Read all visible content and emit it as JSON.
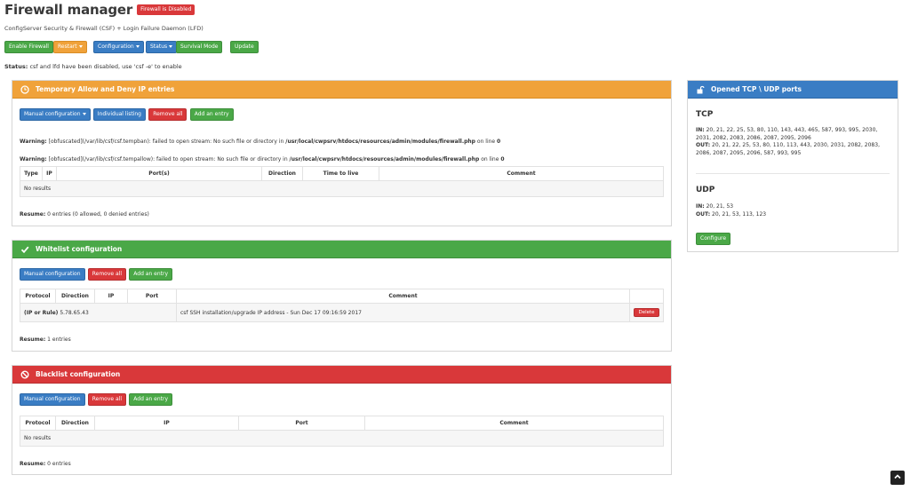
{
  "header": {
    "title": "Firewall manager",
    "badge": "Firewall is Disabled",
    "subtitle": "ConfigServer Security & Firewall (CSF) + Login Failure Daemon (LFD)"
  },
  "toolbar": {
    "enable_firewall": "Enable Firewall",
    "restart": "Restart",
    "configuration": "Configuration",
    "status": "Status",
    "survival_mode": "Survival Mode",
    "update": "Update"
  },
  "status_line": {
    "label": "Status:",
    "text": " csf and lfd have been disabled, use 'csf -e' to enable"
  },
  "temp_panel": {
    "title": "Temporary Allow and Deny IP entries",
    "buttons": {
      "manual": "Manual configuration",
      "individual": "Individual listing",
      "remove_all": "Remove all",
      "add": "Add an entry"
    },
    "warnings": [
      {
        "label": "Warning:",
        "pre": " [obfuscated](/var/lib/csf/csf.tempban): failed to open stream: No such file or directory in ",
        "path": "/usr/local/cwpsrv/htdocs/resources/admin/modules/firewall.php",
        "mid": " on line ",
        "line": "0"
      },
      {
        "label": "Warning:",
        "pre": " [obfuscated](/var/lib/csf/csf.tempallow): failed to open stream: No such file or directory in ",
        "path": "/usr/local/cwpsrv/htdocs/resources/admin/modules/firewall.php",
        "mid": " on line ",
        "line": "0"
      }
    ],
    "columns": [
      "Type",
      "IP",
      "Port(s)",
      "Direction",
      "Time to live",
      "Comment"
    ],
    "empty": "No results",
    "resume_label": "Resume:",
    "resume_text": " 0 entries (0 allowed, 0 denied entries)"
  },
  "whitelist_panel": {
    "title": "Whitelist configuration",
    "buttons": {
      "manual": "Manual configuration",
      "remove_all": "Remove all",
      "add": "Add an entry"
    },
    "columns": [
      "Protocol",
      "Direction",
      "IP",
      "Port",
      "Comment",
      ""
    ],
    "rows": [
      {
        "protocol": "(IP or Rule)",
        "ip": "5.78.65.43",
        "comment": "csf SSH installation/upgrade IP address - Sun Dec 17 09:16:59 2017",
        "action": "Delete"
      }
    ],
    "resume_label": "Resume:",
    "resume_text": " 1 entries"
  },
  "blacklist_panel": {
    "title": "Blacklist configuration",
    "buttons": {
      "manual": "Manual configuration",
      "remove_all": "Remove all",
      "add": "Add an entry"
    },
    "columns": [
      "Protocol",
      "Direction",
      "IP",
      "Port",
      "Comment"
    ],
    "empty": "No results",
    "resume_label": "Resume:",
    "resume_text": " 0 entries"
  },
  "ports_panel": {
    "title": "Opened TCP \\ UDP ports",
    "tcp": {
      "heading": "TCP",
      "in_label": "IN:",
      "in_text": " 20, 21, 22, 25, 53, 80, 110, 143, 443, 465, 587, 993, 995, 2030, 2031, 2082, 2083, 2086, 2087, 2095, 2096",
      "out_label": "OUT:",
      "out_text": " 20, 21, 22, 25, 53, 80, 110, 113, 443, 2030, 2031, 2082, 2083, 2086, 2087, 2095, 2096, 587, 993, 995"
    },
    "udp": {
      "heading": "UDP",
      "in_label": "IN:",
      "in_text": " 20, 21, 53",
      "out_label": "OUT:",
      "out_text": " 20, 21, 53, 113, 123"
    },
    "configure": "Configure"
  },
  "colors": {
    "orange": "#f0a23a",
    "green": "#4aa847",
    "red": "#d9383a",
    "blue": "#3a7dc4"
  },
  "icons": {
    "temp_panel": "clock-icon",
    "whitelist": "check-icon",
    "blacklist": "ban-icon",
    "ports": "unlock-icon",
    "scroll": "chevron-up-icon"
  }
}
